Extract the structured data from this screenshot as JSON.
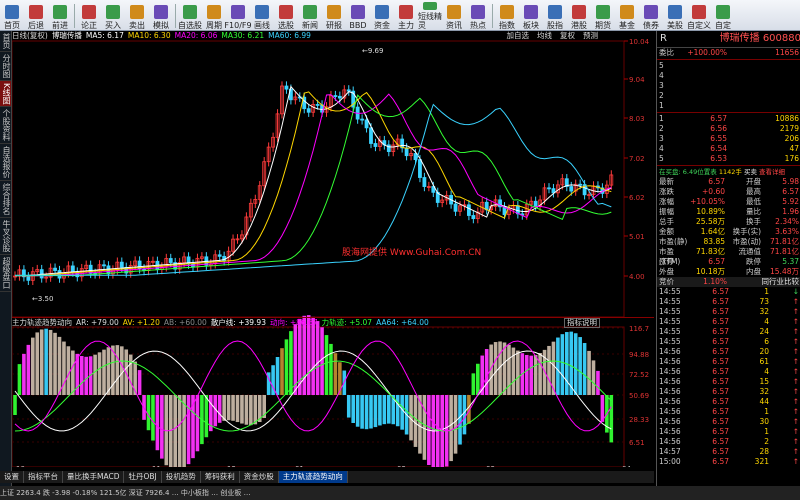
{
  "toolbar": {
    "groups": [
      [
        {
          "label": "首页",
          "icon": "home-icon"
        },
        {
          "label": "后退",
          "icon": "back-icon"
        },
        {
          "label": "前进",
          "icon": "forward-icon"
        }
      ],
      [
        {
          "label": "论正",
          "icon": "doc-icon"
        },
        {
          "label": "买入",
          "icon": "buy-icon"
        },
        {
          "label": "卖出",
          "icon": "sell-icon"
        },
        {
          "label": "模拟",
          "icon": "sim-icon"
        }
      ],
      [
        {
          "label": "自选股",
          "icon": "star-icon"
        },
        {
          "label": "周期",
          "icon": "period-icon"
        },
        {
          "label": "F10/F9",
          "icon": "f10-icon"
        },
        {
          "label": "画线",
          "icon": "draw-icon"
        },
        {
          "label": "选股",
          "icon": "select-icon"
        },
        {
          "label": "新闻",
          "icon": "news-icon"
        },
        {
          "label": "研报",
          "icon": "report-icon"
        },
        {
          "label": "BBD",
          "icon": "bbd-icon"
        },
        {
          "label": "资金",
          "icon": "fund-icon"
        },
        {
          "label": "主力",
          "icon": "main-icon"
        },
        {
          "label": "短线精灵",
          "icon": "sprite-icon"
        },
        {
          "label": "资讯",
          "icon": "info-icon"
        },
        {
          "label": "热点",
          "icon": "hot-icon"
        }
      ],
      [
        {
          "label": "指数",
          "icon": "index-icon"
        },
        {
          "label": "板块",
          "icon": "sector-icon"
        },
        {
          "label": "股指",
          "icon": "futures-icon"
        },
        {
          "label": "港股",
          "icon": "hk-icon"
        },
        {
          "label": "期货",
          "icon": "futures2-icon"
        },
        {
          "label": "基金",
          "icon": "fund2-icon"
        },
        {
          "label": "债券",
          "icon": "bond-icon"
        },
        {
          "label": "美股",
          "icon": "us-icon"
        },
        {
          "label": "自定义",
          "icon": "custom-icon"
        },
        {
          "label": "自定",
          "icon": "custom2-icon"
        }
      ]
    ]
  },
  "leftnav": {
    "items": [
      "首页",
      "分时图",
      "K线图",
      "个股资料",
      "自选报价",
      "综合排名",
      "牛叉诊股",
      "超级盘口"
    ],
    "active": 2
  },
  "chart": {
    "info": [
      {
        "text": "日线(复权)",
        "c": "#ddd"
      },
      {
        "text": "博瑞传播",
        "c": "#fff"
      },
      {
        "text": "MA5: 6.17",
        "c": "#fff"
      },
      {
        "text": "MA10: 6.30",
        "c": "#ffd700"
      },
      {
        "text": "MA20: 6.06",
        "c": "#ff00ff"
      },
      {
        "text": "MA30: 6.21",
        "c": "#33ff33"
      },
      {
        "text": "MA60: 6.99",
        "c": "#3ad3ff"
      }
    ],
    "right_labels": [
      "加自选",
      "均线",
      "复权",
      "预测"
    ],
    "price_axis": [
      "10.04",
      "9.04",
      "8.03",
      "7.02",
      "6.02",
      "5.01",
      "4.00"
    ],
    "high_label": "9.69",
    "low_label": "3.50",
    "watermark": "股海网提供 Www.Guhai.Com.CN",
    "ind_info": [
      {
        "text": "主力轨迹趋势动向",
        "c": "#ddd"
      },
      {
        "text": "AR: +79.00",
        "c": "#ddd"
      },
      {
        "text": "AV: +1.20",
        "c": "#ffd700"
      },
      {
        "text": "AB: +60.00",
        "c": "#888"
      },
      {
        "text": "散户线: +39.93",
        "c": "#fff"
      },
      {
        "text": "动向: +86.67",
        "c": "#ff00ff"
      },
      {
        "text": "力轨迹: +5.07",
        "c": "#33ff33"
      },
      {
        "text": "AA64: +64.00",
        "c": "#3ad3ff"
      }
    ],
    "ind_btn": "指标说明",
    "ind_axis": [
      "116.7",
      "94.88",
      "72.52",
      "50.69",
      "28.33",
      "6.51"
    ],
    "x_labels": [
      "10",
      "11",
      "12",
      "01",
      "02",
      "03",
      "04"
    ]
  },
  "bottom_tabs": [
    "设置",
    "指标平台",
    "量比换手MACD",
    "牡丹OBJ",
    "投机趋势",
    "筹码获利",
    "资金炒股",
    "主力轨迹趋势动向"
  ],
  "bottom_active": 7,
  "right": {
    "code": "600880",
    "name": "博瑞传播",
    "r_label": "R",
    "ratio": {
      "label": "委比",
      "pct": "+100.00%",
      "val": "11656"
    },
    "sell": [
      {
        "l": "5",
        "p": "",
        "v": ""
      },
      {
        "l": "4",
        "p": "",
        "v": ""
      },
      {
        "l": "3",
        "p": "",
        "v": ""
      },
      {
        "l": "2",
        "p": "",
        "v": ""
      },
      {
        "l": "1",
        "p": "",
        "v": ""
      }
    ],
    "buy": [
      {
        "l": "1",
        "p": "6.57",
        "v": "10886"
      },
      {
        "l": "2",
        "p": "6.56",
        "v": "2179"
      },
      {
        "l": "3",
        "p": "6.55",
        "v": "206"
      },
      {
        "l": "4",
        "p": "6.54",
        "v": "47"
      },
      {
        "l": "5",
        "p": "6.53",
        "v": "176"
      }
    ],
    "zai": {
      "a": "在买盘: 6.49位置表",
      "b": "1142手",
      "c": "买卖",
      "d": "查看详细"
    },
    "stats": [
      [
        "最新",
        "6.57",
        "开盘",
        "5.98"
      ],
      [
        "涨跌",
        "+0.60",
        "最高",
        "6.57"
      ],
      [
        "涨幅",
        "+10.05%",
        "最低",
        "5.92"
      ],
      [
        "振幅",
        "10.89%",
        "量比",
        "1.96"
      ],
      [
        "总手",
        "25.58万",
        "换手",
        "2.34%"
      ],
      [
        "金额",
        "1.64亿",
        "换手(实)",
        "3.63%"
      ],
      [
        "市盈(静)",
        "83.85",
        "市盈(动)",
        "71.81亿"
      ],
      [
        "市盈(TTM)",
        "71.83亿",
        "流通值",
        "71.81亿"
      ],
      [
        "涨停",
        "6.57",
        "跌停",
        "5.37"
      ],
      [
        "外盘",
        "10.18万",
        "内盘",
        "15.48万"
      ]
    ],
    "tick_header": {
      "a": "竞价",
      "b": "1.10%",
      "c": "同行业比较"
    },
    "ticks": [
      [
        "14:55",
        "6.57",
        "1",
        "↓"
      ],
      [
        "14:55",
        "6.57",
        "73",
        "↑"
      ],
      [
        "14:55",
        "6.57",
        "32",
        "↑"
      ],
      [
        "14:55",
        "6.57",
        "4",
        "↑"
      ],
      [
        "14:55",
        "6.57",
        "24",
        "↑"
      ],
      [
        "14:55",
        "6.57",
        "6",
        "↑"
      ],
      [
        "14:56",
        "6.57",
        "20",
        "↑"
      ],
      [
        "14:56",
        "6.57",
        "61",
        "↑"
      ],
      [
        "14:56",
        "6.57",
        "4",
        "↑"
      ],
      [
        "14:56",
        "6.57",
        "15",
        "↑"
      ],
      [
        "14:56",
        "6.57",
        "32",
        "↑"
      ],
      [
        "14:56",
        "6.57",
        "44",
        "↑"
      ],
      [
        "14:56",
        "6.57",
        "1",
        "↑"
      ],
      [
        "14:56",
        "6.57",
        "30",
        "↑"
      ],
      [
        "14:56",
        "6.57",
        "1",
        "↑"
      ],
      [
        "14:56",
        "6.57",
        "2",
        "↑"
      ],
      [
        "14:57",
        "6.57",
        "28",
        "↑"
      ],
      [
        "15:00",
        "6.57",
        "321",
        "↑"
      ]
    ]
  },
  "status": "上证 2263.4 跌 -3.98 -0.18% 121.5亿 深证 7926.4 … 中小板指 … 创业板 …"
}
